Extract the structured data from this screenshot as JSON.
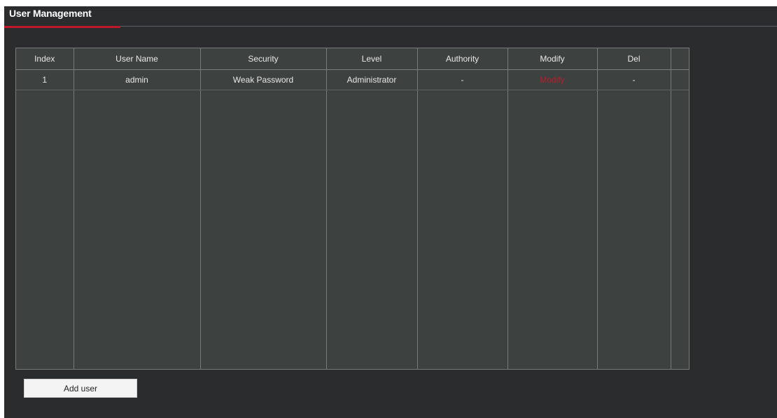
{
  "page": {
    "title": "User Management"
  },
  "table": {
    "columns": [
      "Index",
      "User Name",
      "Security",
      "Level",
      "Authority",
      "Modify",
      "Del"
    ],
    "rows": [
      {
        "index": "1",
        "user_name": "admin",
        "security": "Weak Password",
        "level": "Administrator",
        "authority": "-",
        "modify": "Modify",
        "del": "-"
      }
    ]
  },
  "actions": {
    "add_user_label": "Add user"
  },
  "colors": {
    "background": "#2a2c2e",
    "table_background": "#3d4240",
    "accent": "#c0182a",
    "modify_link": "#b81c28"
  }
}
